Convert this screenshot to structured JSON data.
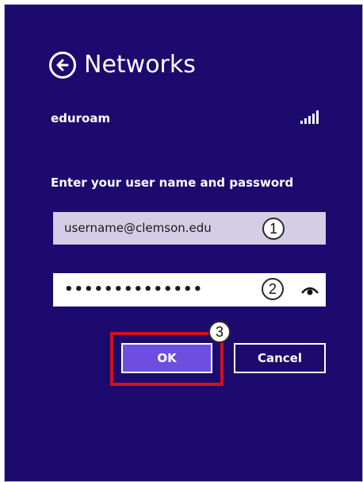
{
  "header": {
    "title": "Networks",
    "back_icon": "back-arrow-icon"
  },
  "network": {
    "name": "eduroam",
    "signal_icon": "wifi-signal-icon"
  },
  "credentials": {
    "prompt": "Enter your user name and password",
    "username_value": "username@clemson.edu",
    "password_value": "••••••••••••••",
    "reveal_icon": "eye-icon"
  },
  "buttons": {
    "ok_label": "OK",
    "cancel_label": "Cancel"
  },
  "callouts": {
    "one": "1",
    "two": "2",
    "three": "3"
  },
  "colors": {
    "background": "#1d0a6e",
    "username_field": "#d3cde5",
    "ok_button": "#6d4fe0",
    "highlight": "#d0121b"
  }
}
